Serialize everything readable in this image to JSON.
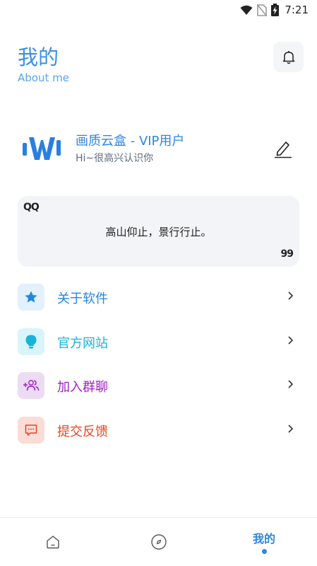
{
  "status_bar": {
    "time": "7:21",
    "icons": [
      "wifi-icon",
      "no-sim-icon",
      "battery-charging-icon"
    ]
  },
  "header": {
    "title": "我的",
    "subtitle": "About me",
    "bell_icon": "bell-icon"
  },
  "profile": {
    "name": "画质云盒 - VIP用户",
    "greeting": "Hi~很高兴认识你",
    "logo": "app-logo",
    "edit_icon": "pencil-icon",
    "accent_color": "#2d86e2"
  },
  "quote": {
    "open_mark": "QQ",
    "text": "高山仰止，景行行止。",
    "close_mark": "99"
  },
  "menu": [
    {
      "label": "关于软件",
      "icon": "star-icon",
      "color": "#1e88e5",
      "bg": "#e3f0fd"
    },
    {
      "label": "官方网站",
      "icon": "lightbulb-icon",
      "color": "#17b4d8",
      "bg": "#d9f4fa"
    },
    {
      "label": "加入群聊",
      "icon": "add-group-icon",
      "color": "#a020c8",
      "bg": "#ecdcf3"
    },
    {
      "label": "提交反馈",
      "icon": "feedback-icon",
      "color": "#e8451f",
      "bg": "#fbdcd7"
    }
  ],
  "bottom_nav": {
    "items": [
      {
        "icon": "home-icon",
        "label": ""
      },
      {
        "icon": "compass-icon",
        "label": ""
      },
      {
        "icon": "",
        "label": "我的"
      }
    ],
    "active_color": "#2d86e2"
  }
}
